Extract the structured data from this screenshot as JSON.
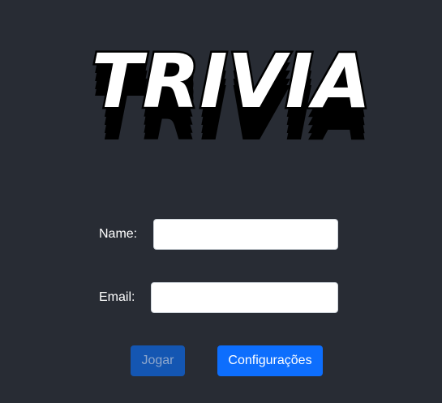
{
  "logo": {
    "text": "TRIVIA"
  },
  "form": {
    "name": {
      "label": "Name:",
      "value": "",
      "placeholder": ""
    },
    "email": {
      "label": "Email:",
      "value": "",
      "placeholder": ""
    }
  },
  "buttons": {
    "play_label": "Jogar",
    "play_disabled": true,
    "settings_label": "Configurações"
  },
  "colors": {
    "background": "#282c34",
    "primary_button": "#0d6efd",
    "disabled_button": "#1456b2",
    "logo_fill": "#ffffff",
    "logo_outline": "#000000"
  }
}
